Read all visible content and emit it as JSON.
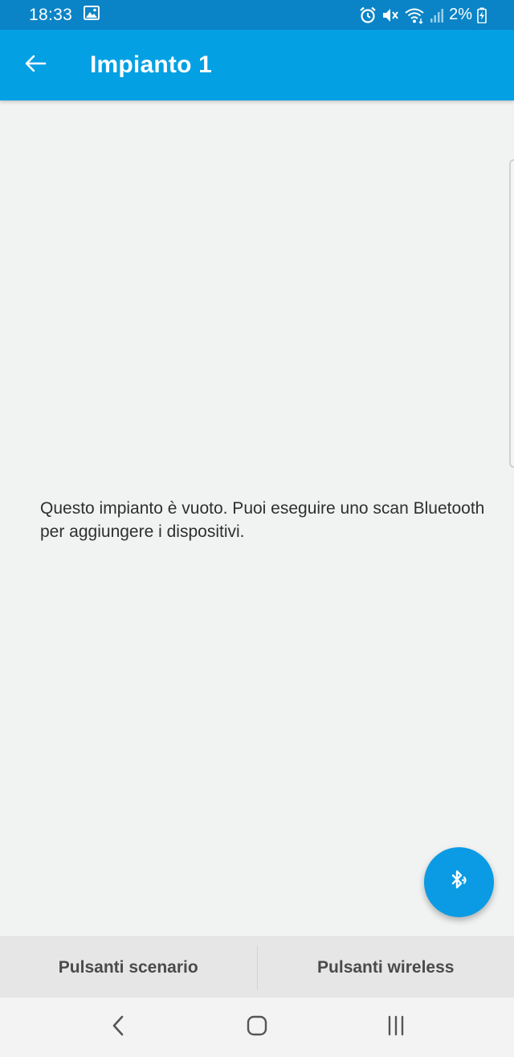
{
  "status_bar": {
    "time": "18:33",
    "battery": "2%",
    "icons": [
      "image-icon",
      "alarm-icon",
      "mute-icon",
      "wifi-icon",
      "signal-icon",
      "battery-charging-icon"
    ]
  },
  "app_bar": {
    "title": "Impianto 1",
    "back_icon": "arrow-back-icon"
  },
  "main": {
    "empty_message": "Questo impianto è vuoto. Puoi eseguire uno scan Bluetooth per aggiungere i dispositivi."
  },
  "fab": {
    "icon": "bluetooth-scan-icon"
  },
  "bottom_bar": {
    "left_label": "Pulsanti scenario",
    "right_label": "Pulsanti wireless"
  },
  "nav_bar": {
    "back": "nav-back-icon",
    "home": "nav-home-icon",
    "recents": "nav-recents-icon"
  },
  "colors": {
    "status_bar": "#0a84c6",
    "app_bar": "#03a0e3",
    "fab": "#0a9be4",
    "background": "#f1f2f2"
  }
}
